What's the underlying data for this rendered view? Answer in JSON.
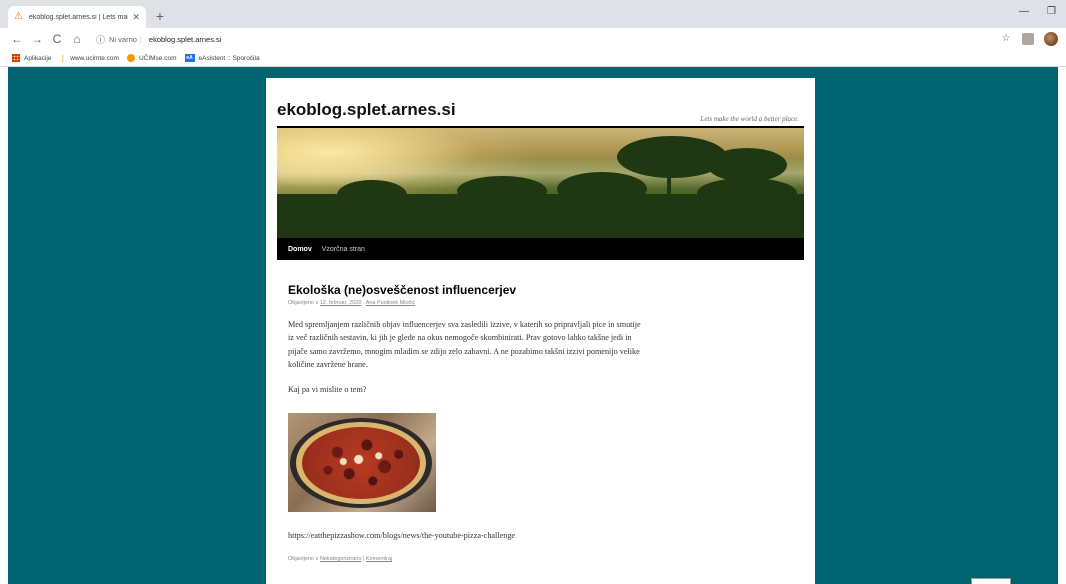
{
  "browser": {
    "tab_title": "ekoblog.splet.arnes.si | Lets mak",
    "omnibox_security": "Ni varno",
    "omnibox_url": "ekoblog.splet.arnes.si"
  },
  "bookmarks": [
    {
      "label": "Aplikacije",
      "icon": "apps-icon"
    },
    {
      "label": "www.ucimte.com",
      "icon": "leaf-icon"
    },
    {
      "label": "UČIMse.com",
      "icon": "dot-icon"
    },
    {
      "label": "eAsistent :: Sporočila",
      "icon": "easistent-icon"
    }
  ],
  "site": {
    "title": "ekoblog.splet.arnes.si",
    "description": "Lets make the world a better place."
  },
  "nav": {
    "home": "Domov",
    "sample_page": "Vzorčna stran"
  },
  "post": {
    "title": "Ekološka (ne)osveščenost influencerjev",
    "meta_prefix": "Objavljeno v",
    "date": "12. februar, 2020",
    "author": "Ana Pustinek Miočić",
    "body": "Med spremljanjem različnih objav influencerjev sva zasledili izzive, v katerih so pripravljali pice in smutije iz več različnih sestavin, ki jih je glede na okus nemogoče skombinirati. Prav gotovo lahko takšne jedi in pijače samo zavržemo,  mnogim mladim se zdijo zelo zabavni.  A ne pozabimo takšni izzivi pomenijo velike količine zavržene hrane.",
    "question": "Kaj pa vi mislite o tem?",
    "link": "https://eatthepizzashow.com/blogs/news/the-youtube-pizza-challenge",
    "footer_prefix": "Objavljeno v",
    "category": "Nekategorizirano",
    "footer_sep": "|",
    "comment": "Komentiraj"
  },
  "colors": {
    "page_background": "#006470",
    "navbar": "#000000"
  }
}
